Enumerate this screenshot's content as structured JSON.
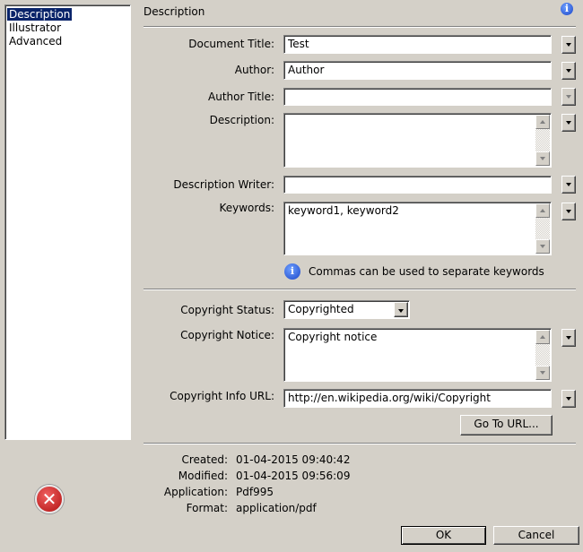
{
  "sidebar": {
    "items": [
      {
        "label": "Description",
        "selected": true
      },
      {
        "label": "Illustrator"
      },
      {
        "label": "Advanced"
      }
    ]
  },
  "header": {
    "title": "Description",
    "info_icon": "info-icon"
  },
  "form": {
    "document_title": {
      "label": "Document Title:",
      "value": "Test"
    },
    "author": {
      "label": "Author:",
      "value": "Author"
    },
    "author_title": {
      "label": "Author Title:",
      "value": ""
    },
    "description": {
      "label": "Description:",
      "value": ""
    },
    "description_writer": {
      "label": "Description Writer:",
      "value": ""
    },
    "keywords": {
      "label": "Keywords:",
      "value": "keyword1, keyword2"
    },
    "keywords_hint": "Commas can be used to separate keywords",
    "copyright_status": {
      "label": "Copyright Status:",
      "value": "Copyrighted"
    },
    "copyright_notice": {
      "label": "Copyright Notice:",
      "value": "Copyright notice"
    },
    "copyright_url": {
      "label": "Copyright Info URL:",
      "value": "http://en.wikipedia.org/wiki/Copyright"
    },
    "go_to_url": "Go To URL..."
  },
  "meta": {
    "created_label": "Created:",
    "created": "01-04-2015 09:40:42",
    "modified_label": "Modified:",
    "modified": "01-04-2015 09:56:09",
    "application_label": "Application:",
    "application": "Pdf995",
    "format_label": "Format:",
    "format": "application/pdf"
  },
  "buttons": {
    "ok": "OK",
    "cancel": "Cancel"
  },
  "colors": {
    "selection": "#0a246a",
    "background": "#d4d0c8",
    "error": "#c81e1e"
  }
}
